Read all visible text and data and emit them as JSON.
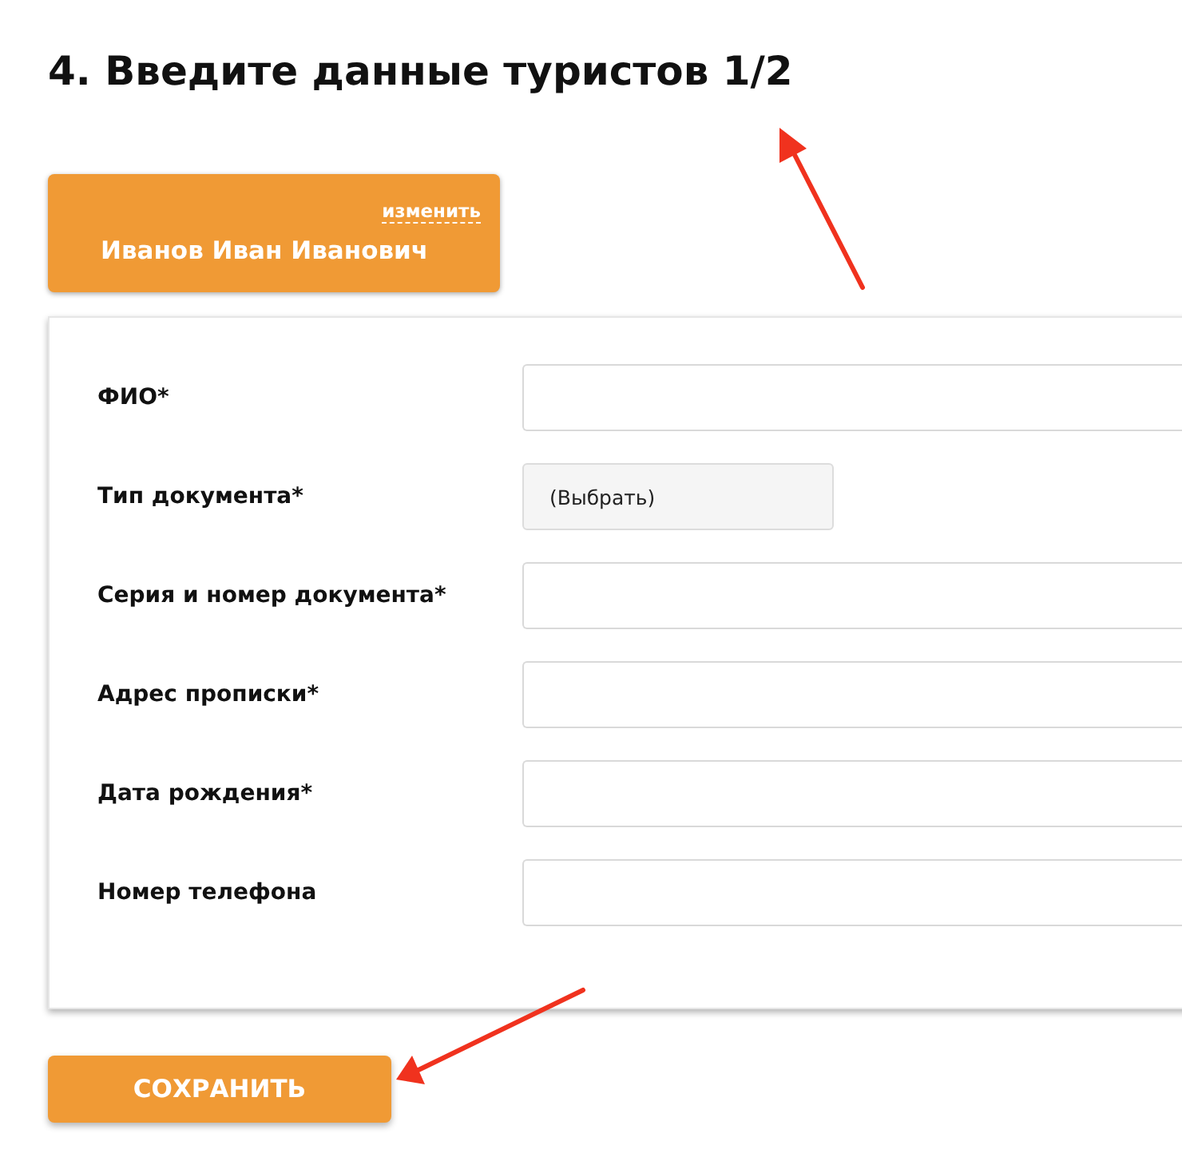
{
  "heading": "4. Введите данные туристов 1/2",
  "tourist_tab": {
    "link": "изменить",
    "name": "Иванов Иван Иванович"
  },
  "fields": [
    {
      "label": "ФИО*",
      "kind": "text"
    },
    {
      "label": "Тип документа*",
      "kind": "select",
      "value": "(Выбрать)"
    },
    {
      "label": "Серия и номер документа*",
      "kind": "text"
    },
    {
      "label": "Адрес прописки*",
      "kind": "text"
    },
    {
      "label": "Дата рождения*",
      "kind": "text"
    },
    {
      "label": "Номер телефона",
      "kind": "text"
    }
  ],
  "save_button": "СОХРАНИТЬ"
}
